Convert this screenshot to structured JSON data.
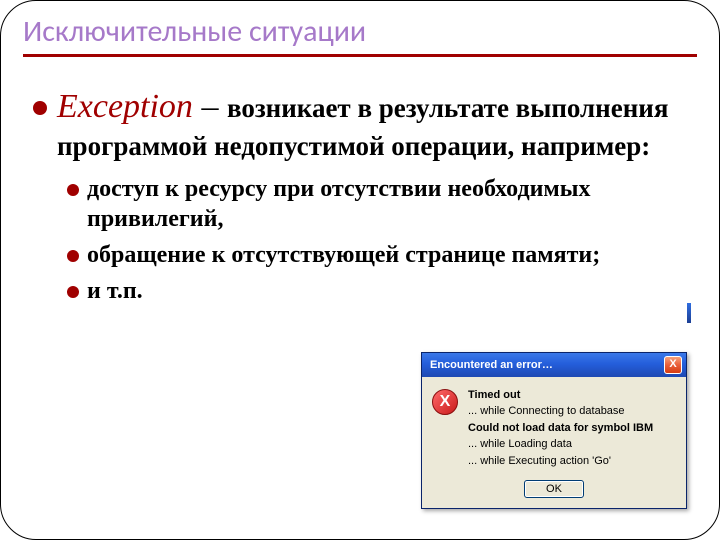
{
  "title": "Исключительные ситуации",
  "main": {
    "term": "Exception",
    "dash": " – ",
    "text": "возникает в результате выполнения программой недопустимой операции, например:"
  },
  "subitems": [
    "доступ к ресурсу при отсутствии необходимых привилегий,",
    "обращение к отсутствующей странице памяти;",
    "и т.п."
  ],
  "dialog": {
    "title": "Encountered an error…",
    "close": "X",
    "icon": "X",
    "lines": {
      "l1": "Timed out",
      "l2": "... while Connecting to database",
      "l3": "Could not load data for symbol IBM",
      "l4": "... while Loading data",
      "l5": "... while Executing action 'Go'"
    },
    "ok": "OK"
  }
}
